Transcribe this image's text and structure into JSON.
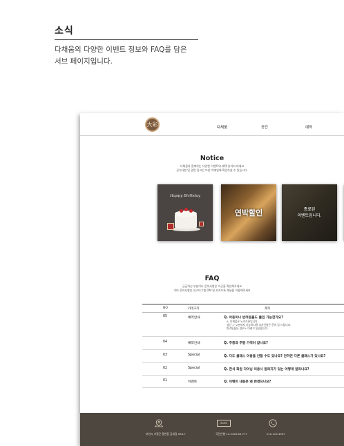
{
  "section": {
    "title": "소식",
    "desc_line1": "다채움의 다양한 이벤트 정보와 FAQ를 담은",
    "desc_line2": "서브 페이지입니다."
  },
  "site": {
    "logo_text": "大彩",
    "nav": [
      "다채움",
      "공간",
      "예약"
    ]
  },
  "notice": {
    "title": "Notice",
    "sub1": "다채움과 함께하는 다양한 이벤트와 혜택 놓치지 마세요",
    "sub2": "공지사항 및 관련 링크는 또한 이메일에 확인하실 수 있습니다.",
    "cards": [
      {
        "caption": "Happy Birthday"
      },
      {
        "caption": "연박할인"
      },
      {
        "caption_line1": "종료된",
        "caption_line2": "이벤트입니다."
      }
    ]
  },
  "faq": {
    "title": "FAQ",
    "sub1": "궁금하신 부분이나 문의사항은 이곳을 확인해주세요",
    "sub2": "기타 문의사항은 인스타그램 DM 및 카카오톡 채널을 이용해주세요",
    "headers": {
      "no": "NO",
      "category": "카테고리",
      "subject": "제목"
    },
    "rows": [
      {
        "no": "05",
        "category": "예약안내",
        "question": "Q. 아동이나 반려동물도 출입 가능한가요?",
        "answer": [
          "A. 다채움은 노키즈존입니다.",
          "성인 1~2분까지 가능하시며 추가인원은 문의 답 드립니다.",
          "반려동물은 경우도 아래고 동일합니다."
        ]
      },
      {
        "no": "04",
        "category": "예약안내",
        "question": "Q. 주중과 주말 가격이 같나요?"
      },
      {
        "no": "03",
        "category": "Special",
        "question": "Q. 다도 클래스 이용을 안할 수도 있나요? 안하면 다른 클래스가 있나요?"
      },
      {
        "no": "02",
        "category": "Special",
        "question": "Q. 한식 화원 다이닝 이용시 알러지가 있는 어떻게 알리나요?"
      },
      {
        "no": "01",
        "category": "이벤트",
        "question": "Q. 이벤트 내용은 왜 변경되나요?"
      }
    ]
  },
  "footer": {
    "address": "부천시 가정곤 용현동 궁네길 638-7",
    "account": "국민은행 12-3456-89-777",
    "bank_icon_label": "BANK",
    "phone": "010.123.4567",
    "icons": [
      "map-pin-icon",
      "bank-card-icon",
      "phone-icon"
    ]
  }
}
